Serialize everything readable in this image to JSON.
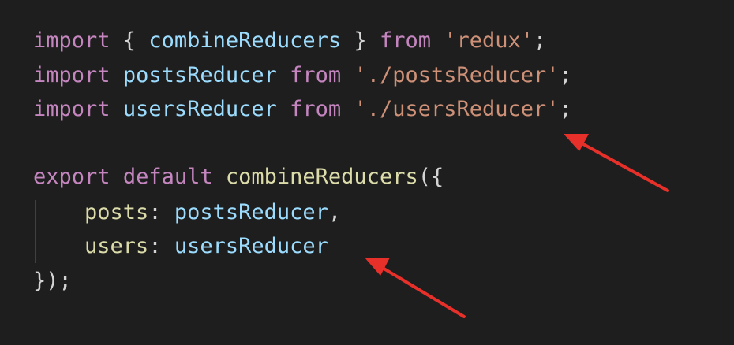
{
  "code": {
    "line1": {
      "kw1": "import",
      "p1": " { ",
      "id": "combineReducers",
      "p2": " } ",
      "kw2": "from",
      "sp": " ",
      "str": "'redux'",
      "end": ";"
    },
    "line2": {
      "kw1": "import",
      "sp1": " ",
      "id": "postsReducer",
      "sp2": " ",
      "kw2": "from",
      "sp3": " ",
      "str": "'./postsReducer'",
      "end": ";"
    },
    "line3": {
      "kw1": "import",
      "sp1": " ",
      "id": "usersReducer",
      "sp2": " ",
      "kw2": "from",
      "sp3": " ",
      "str": "'./usersReducer'",
      "end": ";"
    },
    "line5": {
      "kw1": "export",
      "sp1": " ",
      "kw2": "default",
      "sp2": " ",
      "fn": "combineReducers",
      "end": "({"
    },
    "line6": {
      "indent": "    ",
      "prop": "posts",
      "colon": ": ",
      "val": "postsReducer",
      "end": ","
    },
    "line7": {
      "indent": "    ",
      "prop": "users",
      "colon": ": ",
      "val": "usersReducer"
    },
    "line8": {
      "text": "});"
    }
  },
  "colors": {
    "background": "#1e1e1e",
    "keyword": "#c586c0",
    "identifier": "#9cdcfe",
    "function": "#dcdcaa",
    "string": "#ce9178",
    "arrow": "#e8302a"
  },
  "annotations": [
    {
      "icon": "red-arrow-icon",
      "points_to": "'./usersReducer'"
    },
    {
      "icon": "red-arrow-icon",
      "points_to": "usersReducer"
    }
  ]
}
